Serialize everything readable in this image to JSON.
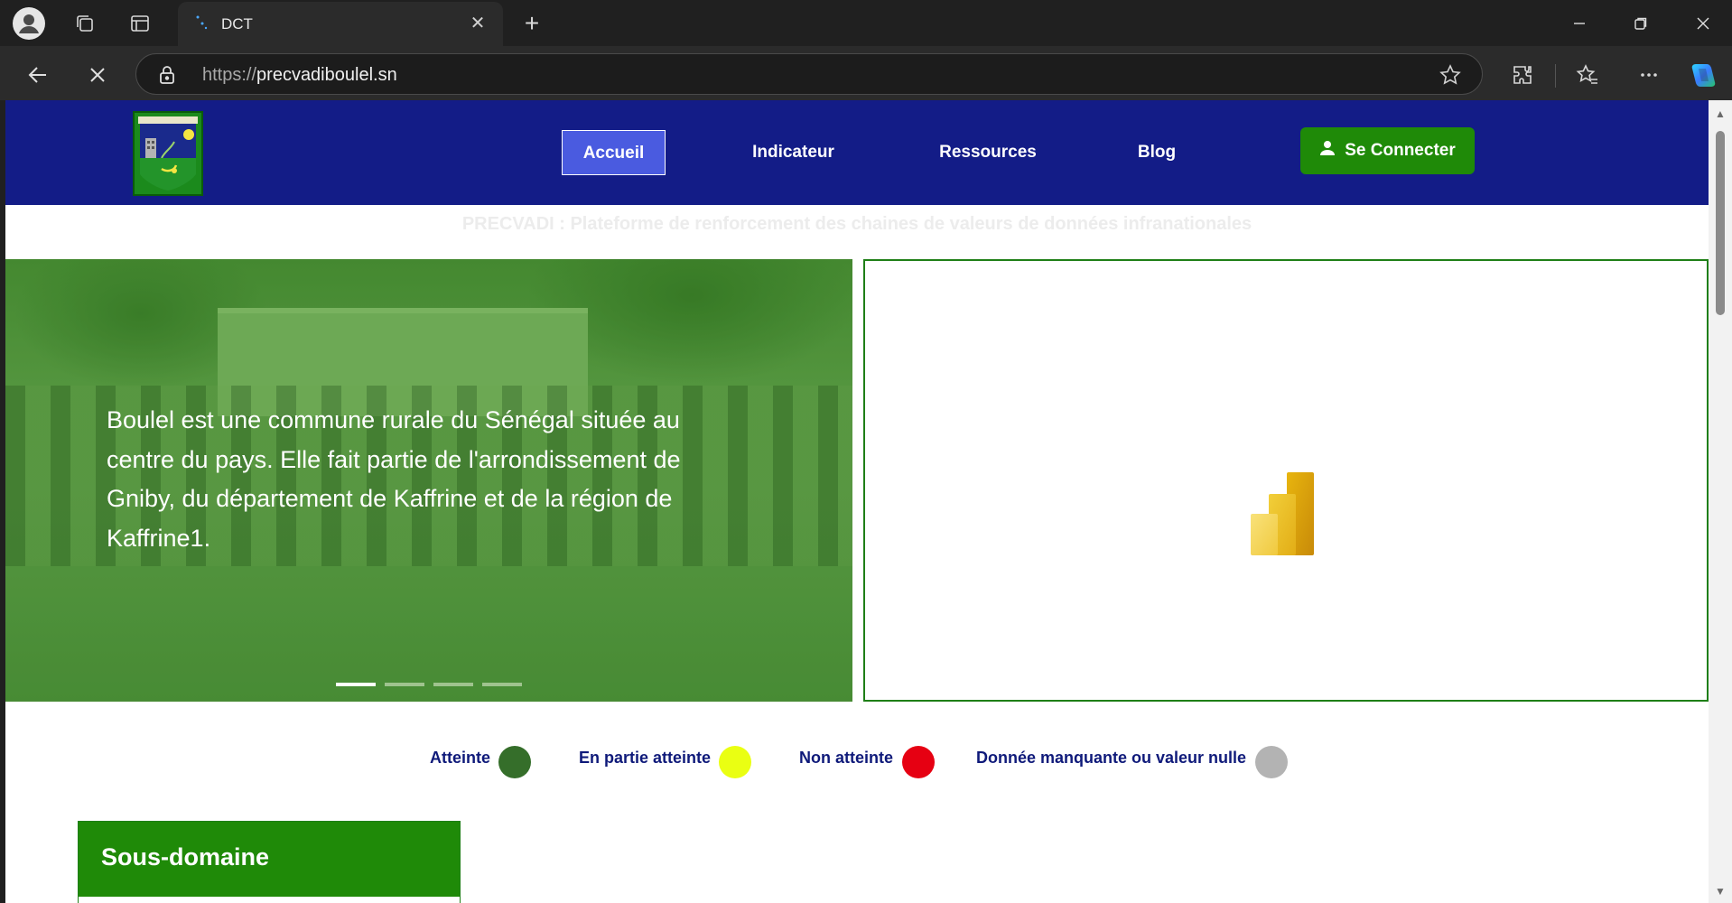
{
  "browser": {
    "tab_title": "DCT",
    "url_scheme": "https://",
    "url_host": "precvadiboulel.sn",
    "icons": [
      "profile-icon",
      "workspaces-icon",
      "tab-actions-icon",
      "close-tab-icon",
      "new-tab-icon",
      "back-icon",
      "stop-icon",
      "lock-icon",
      "favorite-star-icon",
      "extensions-icon",
      "favorites-icon",
      "more-icon",
      "copilot-icon",
      "minimize-icon",
      "restore-icon",
      "close-window-icon"
    ]
  },
  "site": {
    "nav": {
      "items": [
        "Accueil",
        "Indicateur",
        "Ressources",
        "Blog"
      ],
      "active": "Accueil",
      "connect_label": "Se Connecter"
    },
    "subtitle": "PRECVADI : Plateforme de renforcement des chaines de valeurs de données infranationales",
    "hero": {
      "text": "Boulel est une commune rurale du Sénégal située au centre du pays. Elle fait partie de l'arrondissement de Gniby, du département de Kaffrine et de la région de Kaffrine1.",
      "slides": 4,
      "active_slide": 1
    },
    "legend": [
      {
        "label": "Atteinte",
        "color": "#356e2a"
      },
      {
        "label": "En partie atteinte",
        "color": "#eaff12"
      },
      {
        "label": "Non atteinte",
        "color": "#e60012"
      },
      {
        "label": "Donnée manquante ou valeur nulle",
        "color": "#b3b3b3"
      }
    ],
    "subdomain_title": "Sous-domaine"
  },
  "colors": {
    "header_bg": "#131c87",
    "brand_green": "#1f8a08",
    "nav_active": "#4a5be0"
  }
}
